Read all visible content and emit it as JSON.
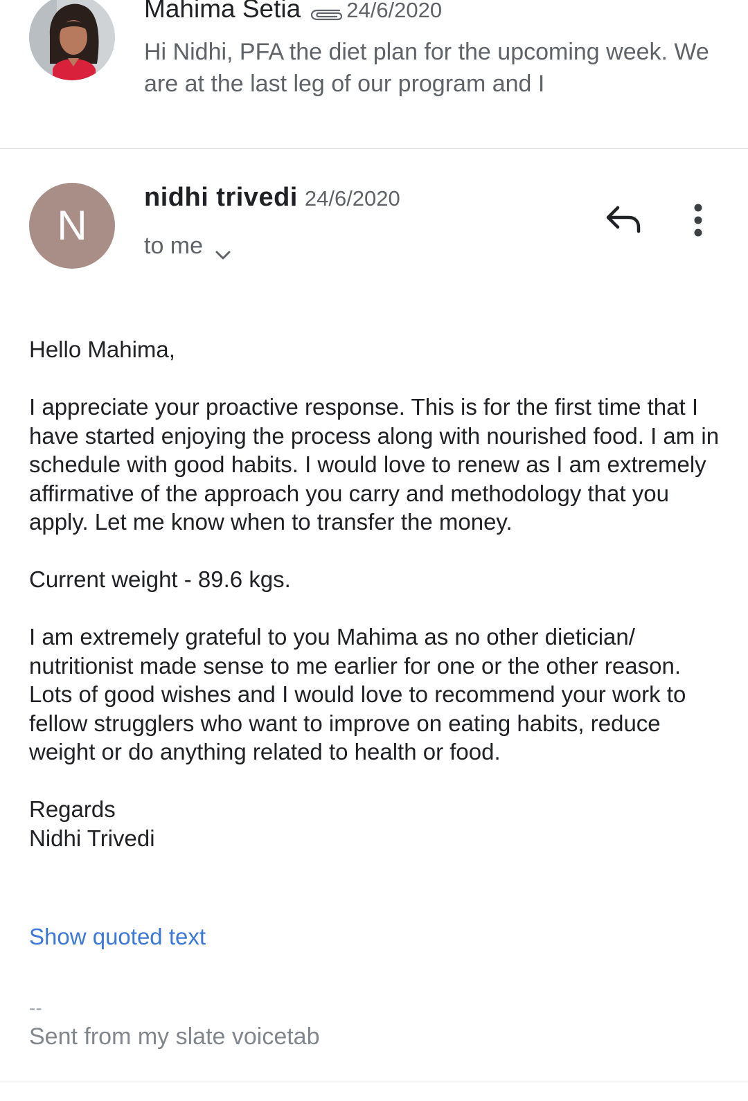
{
  "collapsed_message": {
    "sender": "Mahima Setia",
    "date": "24/6/2020",
    "has_attachment_icon": "paperclip-icon",
    "snippet": "Hi Nidhi, PFA the diet plan for the upcoming week. We are at the last leg of our program and I"
  },
  "message": {
    "avatar_letter": "N",
    "avatar_color": "#a88e86",
    "sender": "nidhi trivedi",
    "date": "24/6/2020",
    "recipient": "to me",
    "icons": {
      "expand": "chevron-down-icon",
      "reply": "reply-icon",
      "more": "more-vert-icon"
    },
    "body": {
      "greeting": "Hello Mahima,",
      "paragraph_1": "I appreciate your proactive response. This is for the first time that I have started enjoying the process along with nourished food. I am in schedule with good habits. I would love to renew as I am extremely affirmative of the approach you carry and methodology that you apply. Let me know when to transfer the money.",
      "weight_line": "Current weight - 89.6 kgs.",
      "paragraph_2": "I am extremely grateful to you Mahima as no other dietician/ nutritionist made sense to me earlier for one or the other reason. Lots of good wishes and I would love to recommend your work to fellow strugglers who want to improve on eating habits, reduce weight or do anything related to health or food.",
      "closing": "Regards",
      "signature_name": "Nidhi Trivedi"
    },
    "show_quoted_label": "Show quoted text",
    "signature_separator": "--",
    "signature_text": "Sent from my slate voicetab",
    "link_color": "#3b78d8"
  }
}
